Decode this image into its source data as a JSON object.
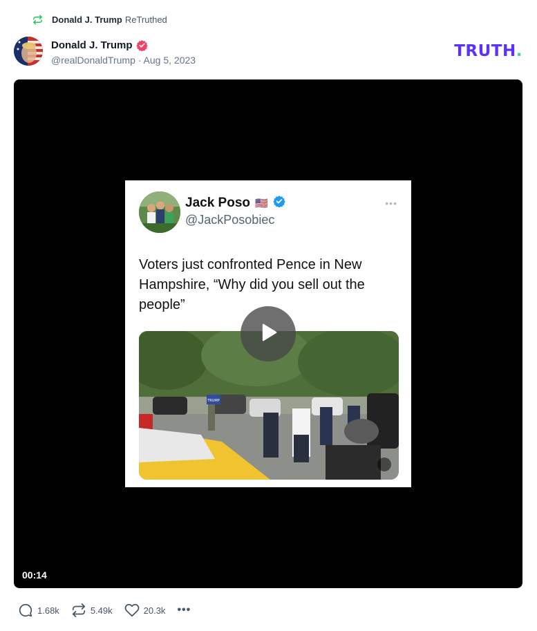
{
  "retruth": {
    "icon": "retruth-icon",
    "name": "Donald J. Trump",
    "label": "ReTruthed",
    "accent_color": "#22c55e"
  },
  "author": {
    "name": "Donald J. Trump",
    "handle": "@realDonaldTrump",
    "separator": "·",
    "date": "Aug 5, 2023",
    "verified_color": "#ef4469"
  },
  "brand": {
    "logo_main": "TRUTH",
    "logo_dot": ".",
    "color": "#5a32fa",
    "dot_color": "#37d3b2"
  },
  "video": {
    "timecode": "00:14",
    "embedded_tweet": {
      "name": "Jack Poso",
      "flag": "🇺🇸",
      "handle": "@JackPosobiec",
      "more": "•••",
      "text": "Voters just confronted Pence in New Hampshire, “Why did you sell out the people”",
      "media_sign": "TRUMP"
    }
  },
  "actions": {
    "replies": "1.68k",
    "retruths": "5.49k",
    "likes": "20.3k",
    "more": "•••"
  }
}
